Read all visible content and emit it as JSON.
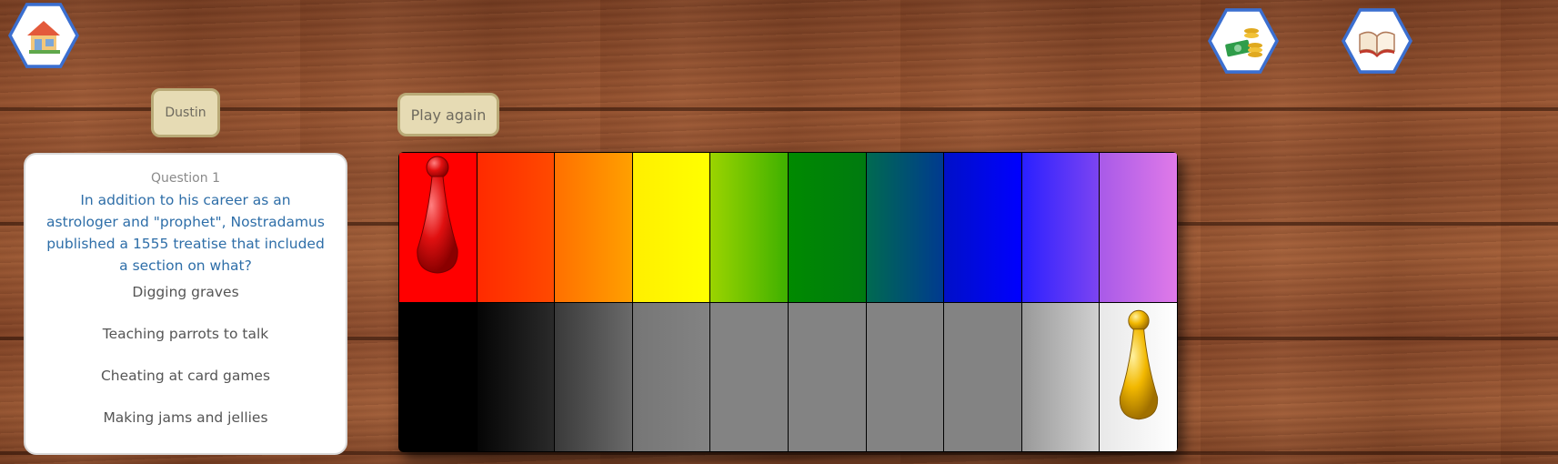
{
  "nav": {
    "home_icon": "house-icon",
    "coins_icon": "money-coins-icon",
    "book_icon": "open-book-icon"
  },
  "player": {
    "name": "Dustin"
  },
  "controls": {
    "play_again_label": "Play again"
  },
  "question": {
    "number_label": "Question 1",
    "text": "In addition to his career as an astrologer and \"prophet\", Nostradamus published a 1555 treatise that included a section on what?",
    "answers": [
      "Digging graves",
      "Teaching parrots to talk",
      "Cheating at card games",
      "Making jams and jellies"
    ]
  },
  "board": {
    "top_row_colors": [
      [
        "#ff0000",
        "#ff0000"
      ],
      [
        "#ff2a00",
        "#ff4a00"
      ],
      [
        "#ff7000",
        "#ffa000"
      ],
      [
        "#ffef00",
        "#ffff00"
      ],
      [
        "#9bd400",
        "#3fb000"
      ],
      [
        "#008a00",
        "#007a10"
      ],
      [
        "#006a50",
        "#003a90"
      ],
      [
        "#0010c8",
        "#0000ff"
      ],
      [
        "#2a20ff",
        "#7c44f2"
      ],
      [
        "#a85ae8",
        "#e07ae8"
      ]
    ],
    "bottom_row_colors": [
      [
        "#000000",
        "#000000"
      ],
      [
        "#050505",
        "#2a2a2a"
      ],
      [
        "#3a3a3a",
        "#6a6a6a"
      ],
      [
        "#767676",
        "#838383"
      ],
      [
        "#838383",
        "#838383"
      ],
      [
        "#838383",
        "#838383"
      ],
      [
        "#838383",
        "#838383"
      ],
      [
        "#838383",
        "#838383"
      ],
      [
        "#999999",
        "#d0d0d0"
      ],
      [
        "#e8e8e8",
        "#ffffff"
      ]
    ],
    "red_pawn": {
      "color": "#e01010",
      "row": 0,
      "column": 0
    },
    "yellow_pawn": {
      "color": "#f2b800",
      "row": 1,
      "column": 9
    }
  }
}
